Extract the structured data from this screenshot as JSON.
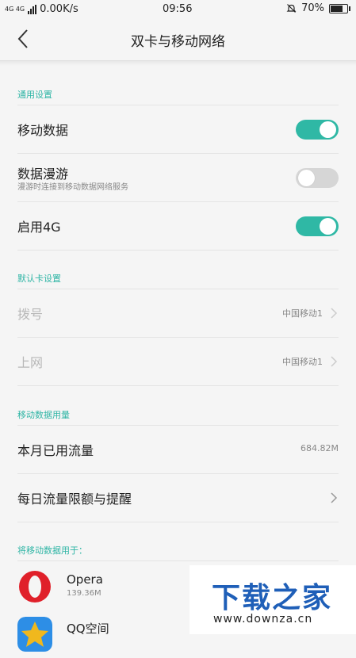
{
  "status_bar": {
    "network_badge": "4G 4G",
    "speed": "0.00K/s",
    "time": "09:56",
    "battery": "70%",
    "battery_level": 0.7
  },
  "header": {
    "title": "双卡与移动网络"
  },
  "general": {
    "section_label": "通用设置",
    "mobile_data": {
      "label": "移动数据",
      "on": true
    },
    "roaming": {
      "label": "数据漫游",
      "sub": "漫游时连接到移动数据网络服务",
      "on": false
    },
    "enable_4g": {
      "label": "启用4G",
      "on": true
    }
  },
  "default_card": {
    "section_label": "默认卡设置",
    "dial": {
      "label": "拨号",
      "value": "中国移动1"
    },
    "internet": {
      "label": "上网",
      "value": "中国移动1"
    }
  },
  "usage": {
    "section_label": "移动数据用量",
    "month": {
      "label": "本月已用流量",
      "value": "684.82M"
    },
    "daily": {
      "label": "每日流量限额与提醒"
    }
  },
  "apps": {
    "section_label": "将移动数据用于：",
    "items": [
      {
        "name": "Opera",
        "size": "139.36M",
        "color": "#e0202a"
      },
      {
        "name": "QQ空间",
        "size": "",
        "color": "#f0b81d"
      }
    ]
  },
  "watermark": {
    "main": "下载之家",
    "url": "www.downza.cn"
  },
  "colors": {
    "accent": "#2fb8a5"
  }
}
